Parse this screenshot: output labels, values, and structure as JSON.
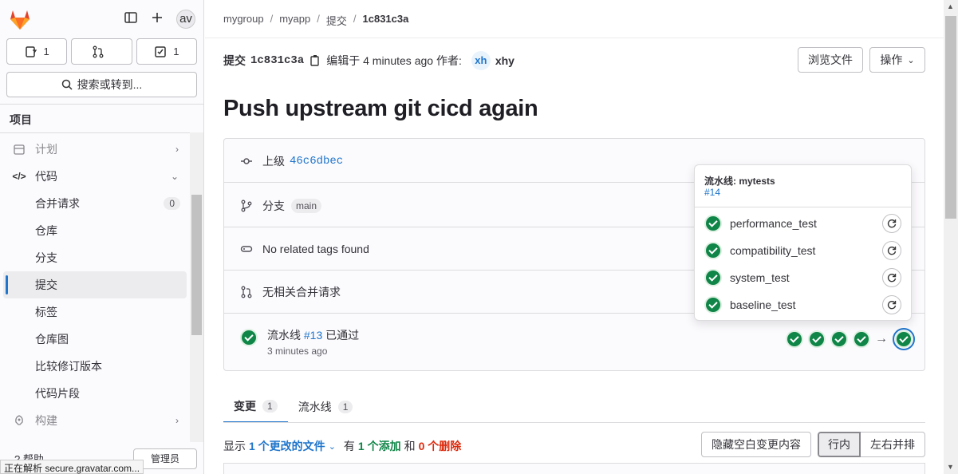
{
  "sidebar": {
    "avatar": "av",
    "counters": [
      {
        "icon": "issues-icon",
        "count": "1"
      },
      {
        "icon": "merge-request-icon",
        "count": ""
      },
      {
        "icon": "todo-icon",
        "count": "1"
      }
    ],
    "search_label": "搜索或转到...",
    "section_title": "项目",
    "nav": {
      "plan": "计划",
      "code": "代码",
      "code_items": [
        {
          "label": "合并请求",
          "badge": "0"
        },
        {
          "label": "仓库"
        },
        {
          "label": "分支"
        },
        {
          "label": "提交"
        },
        {
          "label": "标签"
        },
        {
          "label": "仓库图"
        },
        {
          "label": "比较修订版本"
        },
        {
          "label": "代码片段"
        }
      ],
      "build": "构建"
    },
    "help": "帮助",
    "admin": "管理员"
  },
  "status_bar": "正在解析 secure.gravatar.com...",
  "breadcrumb": [
    "mygroup",
    "myapp",
    "提交",
    "1c831c3a"
  ],
  "commit": {
    "label": "提交",
    "sha": "1c831c3a",
    "authored": "编辑于 4 minutes ago 作者:",
    "author_initials": "xh",
    "author": "xhy",
    "title": "Push upstream git cicd again",
    "browse_files": "浏览文件",
    "actions": "操作"
  },
  "info": {
    "parent_label": "上级",
    "parent_sha": "46c6dbec",
    "branch_label": "分支",
    "branch": "main",
    "tags": "No related tags found",
    "mr": "无相关合并请求",
    "pipeline_prefix": "流水线",
    "pipeline_id": "#13",
    "pipeline_status": "已通过",
    "pipeline_time": "3 minutes ago"
  },
  "popover": {
    "title": "流水线: mytests",
    "link": "#14",
    "jobs": [
      "performance_test",
      "compatibility_test",
      "system_test",
      "baseline_test"
    ]
  },
  "tabs": [
    {
      "label": "变更",
      "count": "1"
    },
    {
      "label": "流水线",
      "count": "1"
    }
  ],
  "diff": {
    "show": "显示",
    "files": "1 个更改的文件",
    "has": "有",
    "added": "1 个添加",
    "and": "和",
    "deleted": "0 个删除",
    "hide_ws": "隐藏空白变更内容",
    "inline": "行内",
    "parallel": "左右并排"
  },
  "colors": {
    "success": "#108548",
    "link": "#1f75cb",
    "danger": "#dd2b0e"
  }
}
